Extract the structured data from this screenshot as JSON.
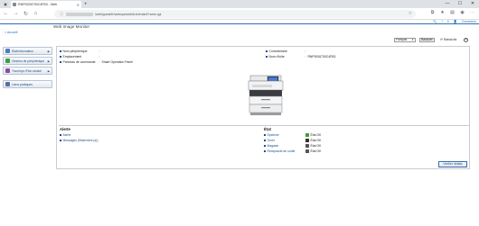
{
  "browser": {
    "tab_title": "RNP0026730C4FB3 - Web",
    "url_path": "/web/guest/fr/websys/webArch/mainFrame.cgi",
    "new_tab": "+",
    "win_min": "—",
    "win_max": "☐",
    "win_close": "✕"
  },
  "header": {
    "util_links": [
      "🔍",
      "?",
      "ℹ",
      "👤",
      "Connexion"
    ],
    "home_link": "< Accueil",
    "title": "Web Image Monitor"
  },
  "sidebar": {
    "items": [
      {
        "label": "État/Information",
        "icon_color": "#4a7fc1"
      },
      {
        "label": "Gestion de périphérique",
        "icon_color": "#3e9d3e"
      },
      {
        "label": "Trav.Impr./Fich.stocké",
        "icon_color": "#8a4ca8"
      },
      {
        "label": "Liens pratiques",
        "icon_color": "#5a6fa0"
      }
    ]
  },
  "toolbar": {
    "language": "Français",
    "ok_label": "Basculer",
    "refresh_label": "Rafraîchir",
    "help_label": "?"
  },
  "device_info": {
    "left": [
      {
        "label": "Nom périphérique",
        "value": ""
      },
      {
        "label": "Emplacement",
        "value": ""
      },
      {
        "label": "Panneau de commande",
        "value": "Smart Operation Panel"
      }
    ],
    "right": [
      {
        "label": "Commentaire",
        "value": ""
      },
      {
        "label": "Nom d'hôte",
        "value": "RNP0026730C4FB3"
      }
    ]
  },
  "alert": {
    "title": "Alerte",
    "items": [
      "Alerte",
      "Messages (Statement (s))"
    ]
  },
  "status": {
    "title": "État",
    "items": [
      {
        "label": "Système",
        "value": "État OK",
        "icon": "check-icon",
        "icon_color": "#3e9d3e"
      },
      {
        "label": "Toner",
        "value": "État OK",
        "icon": "toner-icon",
        "icon_color": "#333333"
      },
      {
        "label": "Magasin",
        "value": "État OK",
        "icon": "tray-icon",
        "icon_color": "#555555"
      },
      {
        "label": "Réceptacle de sortie",
        "value": "État OK",
        "icon": "output-tray-icon",
        "icon_color": "#555555"
      }
    ]
  },
  "verify_label": "Vérifier détails"
}
